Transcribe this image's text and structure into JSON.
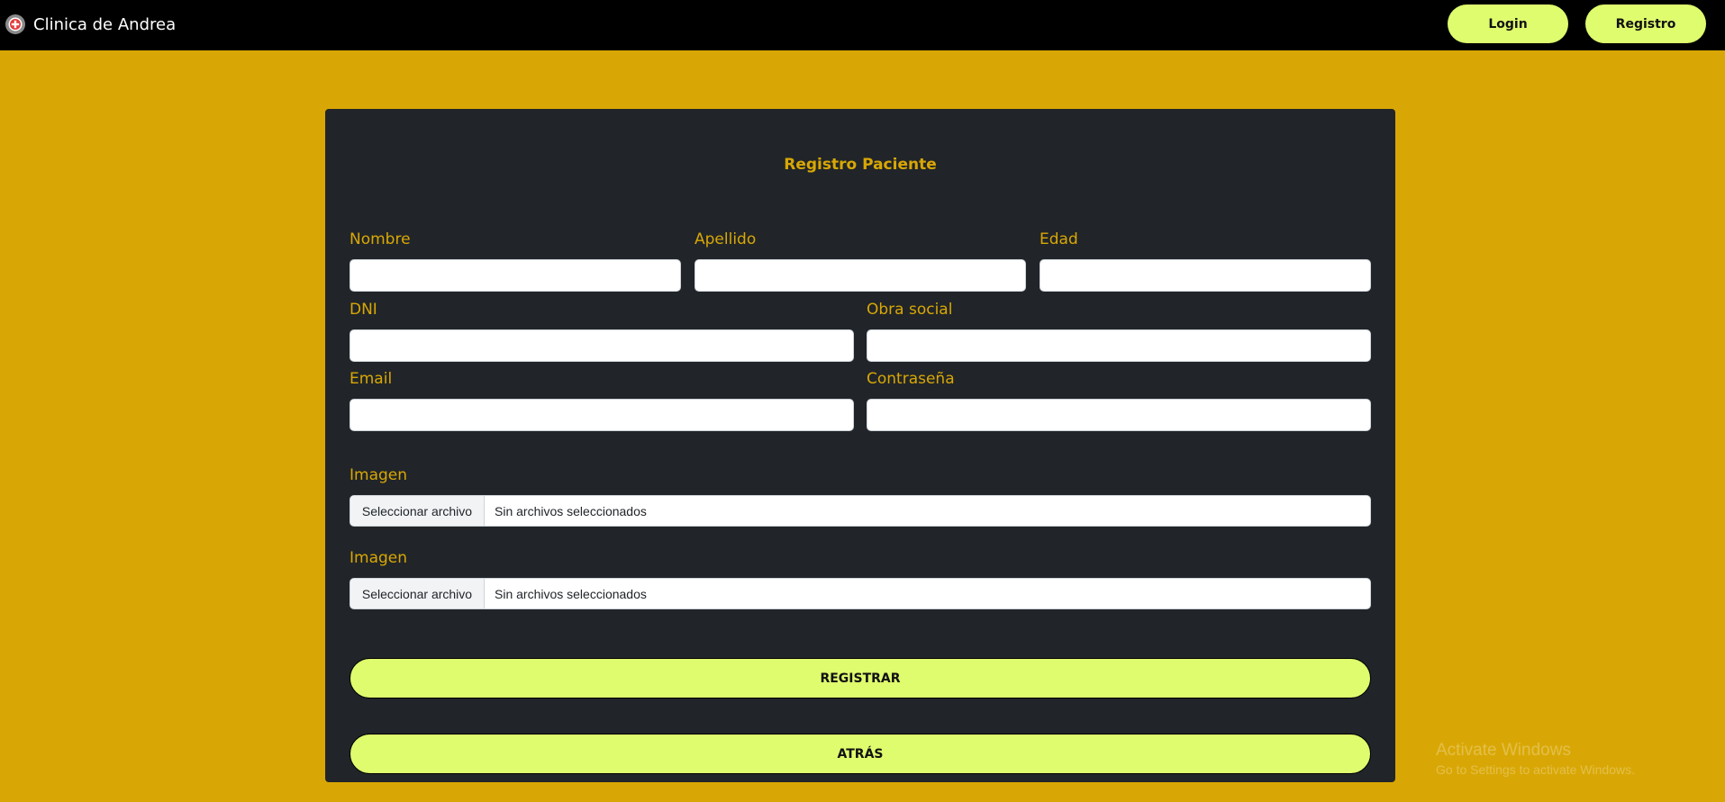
{
  "navbar": {
    "brand_icon": "medical-cross-icon",
    "brand_text": "Clinica de Andrea",
    "login_label": "Login",
    "registro_label": "Registro"
  },
  "form": {
    "title": "Registro Paciente",
    "fields": {
      "nombre": {
        "label": "Nombre",
        "value": ""
      },
      "apellido": {
        "label": "Apellido",
        "value": ""
      },
      "edad": {
        "label": "Edad",
        "value": ""
      },
      "dni": {
        "label": "DNI",
        "value": ""
      },
      "obra_social": {
        "label": "Obra social",
        "value": ""
      },
      "email": {
        "label": "Email",
        "value": ""
      },
      "contrasena": {
        "label": "Contraseña",
        "value": ""
      }
    },
    "images": [
      {
        "label": "Imagen",
        "button": "Seleccionar archivo",
        "status": "Sin archivos seleccionados"
      },
      {
        "label": "Imagen",
        "button": "Seleccionar archivo",
        "status": "Sin archivos seleccionados"
      }
    ],
    "submit_label": "REGISTRAR",
    "back_label": "ATRÁS"
  },
  "watermark": {
    "title": "Activate Windows",
    "subtitle": "Go to Settings to activate Windows."
  },
  "colors": {
    "background": "#d9a705",
    "navbar": "#000000",
    "card": "#212529",
    "accent_text": "#d9a705",
    "button": "#dffc6e"
  }
}
